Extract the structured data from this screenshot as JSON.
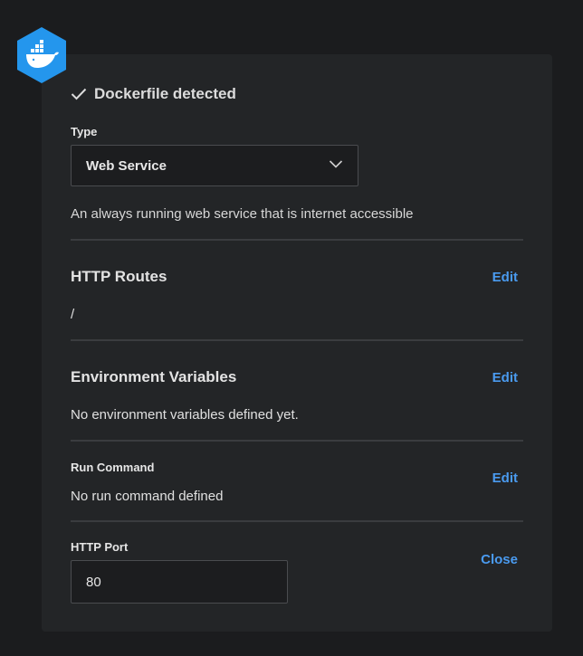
{
  "header": {
    "logo_icon": "docker-whale-icon",
    "detected_text": "Dockerfile detected"
  },
  "type_field": {
    "label": "Type",
    "selected": "Web Service",
    "description": "An always running web service that is internet accessible"
  },
  "http_routes": {
    "title": "HTTP Routes",
    "edit_label": "Edit",
    "value": "/"
  },
  "env_vars": {
    "title": "Environment Variables",
    "edit_label": "Edit",
    "value": "No environment variables defined yet."
  },
  "run_command": {
    "label": "Run Command",
    "edit_label": "Edit",
    "value": "No run command defined"
  },
  "http_port": {
    "label": "HTTP Port",
    "close_label": "Close",
    "value": "80"
  },
  "colors": {
    "background": "#1b1c1e",
    "card": "#232527",
    "accent_link": "#4a9bf0",
    "docker_blue": "#2496ed"
  }
}
